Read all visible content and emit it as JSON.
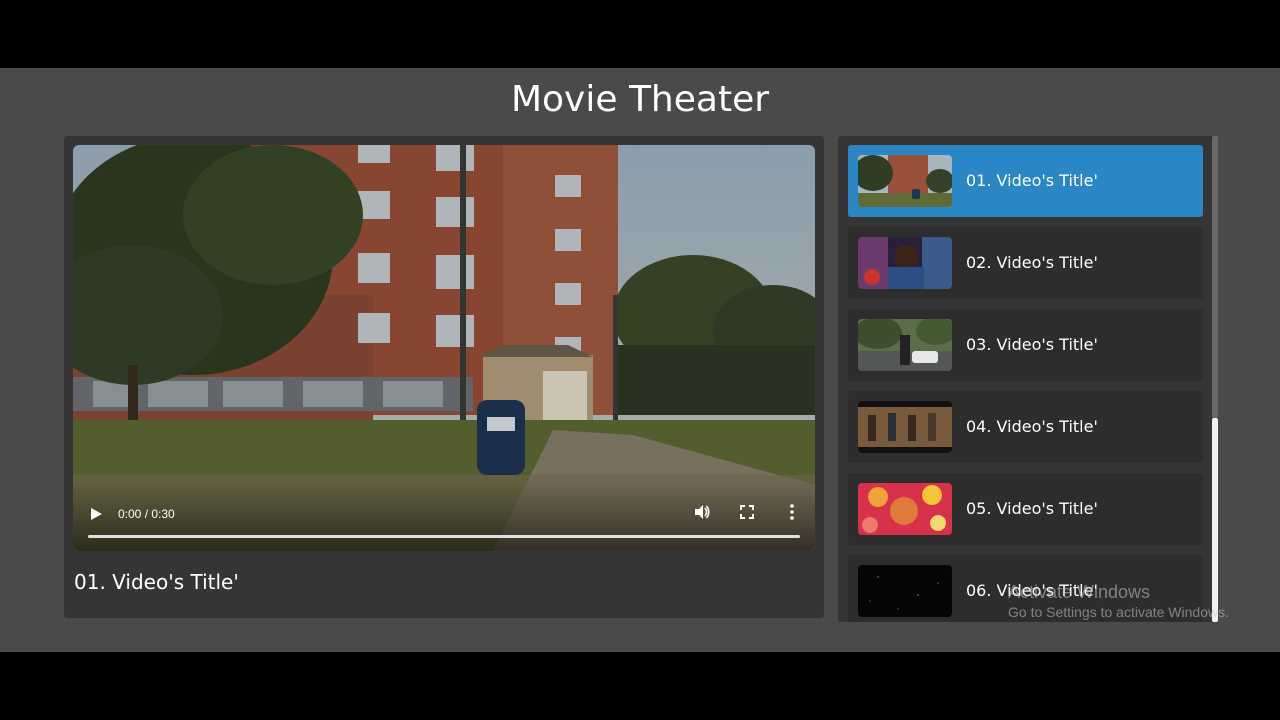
{
  "page": {
    "title": "Movie Theater"
  },
  "player": {
    "time_display": "0:00 / 0:30",
    "current_title": "01. Video's Title'",
    "progress": 0,
    "controls": {
      "play_icon": "play-icon",
      "volume_icon": "volume-icon",
      "fullscreen_icon": "fullscreen-icon",
      "more_icon": "more-vertical-icon"
    }
  },
  "playlist": {
    "active_color": "#2b86c5",
    "items": [
      {
        "title": "01. Video's Title'",
        "active": true
      },
      {
        "title": "02. Video's Title'",
        "active": false
      },
      {
        "title": "03. Video's Title'",
        "active": false
      },
      {
        "title": "04. Video's Title'",
        "active": false
      },
      {
        "title": "05. Video's Title'",
        "active": false
      },
      {
        "title": "06. Video's Title'",
        "active": false
      }
    ]
  },
  "overlay": {
    "watermark_line1": "Activate Windows",
    "watermark_line2": "Go to Settings to activate Windows."
  }
}
